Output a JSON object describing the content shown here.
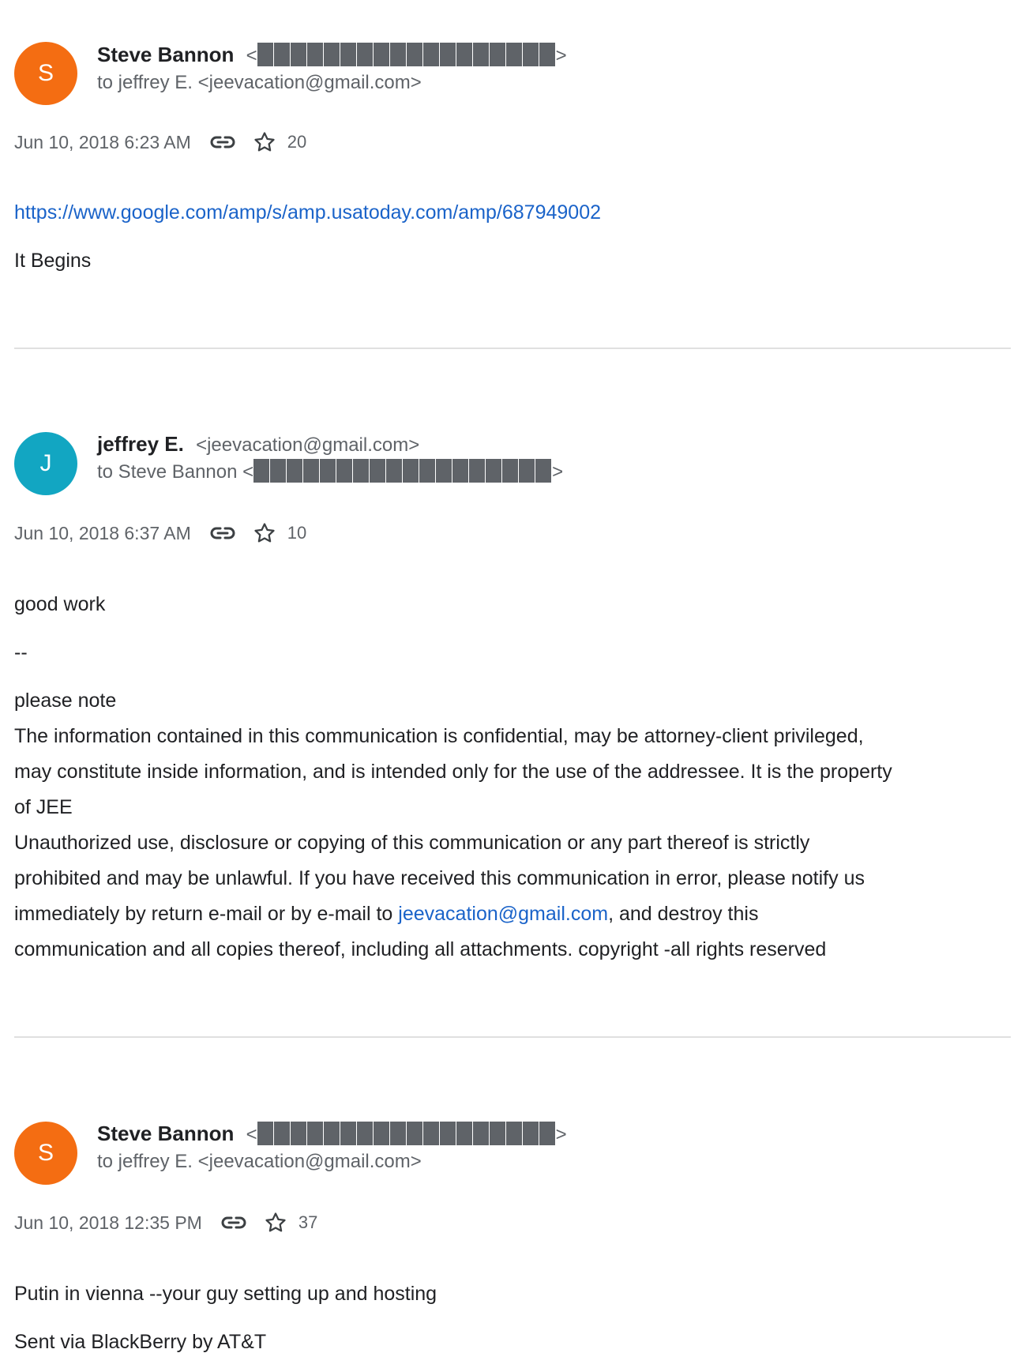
{
  "messages": [
    {
      "avatar_letter": "S",
      "avatar_color": "#f46d12",
      "sender_name": "Steve Bannon",
      "sender_addr_open": "<",
      "sender_addr_close": ">",
      "recipient_line": "to jeffrey E. <jeevacation@gmail.com>",
      "timestamp": "Jun 10, 2018 6:23 AM",
      "star_count": "20",
      "link_text": "https://www.google.com/amp/s/amp.usatoday.com/amp/687949002",
      "body": "It Begins"
    },
    {
      "avatar_letter": "J",
      "avatar_color": "#12a6c2",
      "sender_name": "jeffrey E.",
      "sender_addr": "<jeevacation@gmail.com>",
      "recipient_prefix": "to Steve Bannon <",
      "recipient_suffix": ">",
      "timestamp": "Jun 10, 2018 6:37 AM",
      "star_count": "10",
      "body_line1": "good work",
      "body_sig": "--",
      "disclaimer_title": "please note",
      "disclaimer_lines": [
        "The information contained in this communication is confidential, may be attorney-client privileged,",
        "may constitute inside information, and is intended only for the use of the addressee. It is the property",
        "of JEE",
        "Unauthorized use, disclosure or copying of this communication or any part thereof is strictly",
        "prohibited and may be unlawful. If you have received this communication in error, please notify us"
      ],
      "disclaimer_line6_pre": "immediately by return e-mail or by e-mail to ",
      "disclaimer_line6_link": "jeevacation@gmail.com",
      "disclaimer_line6_post": ", and destroy this",
      "disclaimer_line7": "communication and all copies thereof, including all attachments. copyright -all rights reserved"
    },
    {
      "avatar_letter": "S",
      "avatar_color": "#f46d12",
      "sender_name": "Steve Bannon",
      "sender_addr_open": "<",
      "sender_addr_close": ">",
      "recipient_line": "to jeffrey E. <jeevacation@gmail.com>",
      "timestamp": "Jun 10, 2018 12:35 PM",
      "star_count": "37",
      "body": "Putin in vienna --your guy setting up and hosting",
      "signature": "Sent via BlackBerry by AT&T"
    }
  ],
  "colors": {
    "link": "#1a63c9",
    "meta_text": "#5f6368",
    "redaction": "#5f6368",
    "divider": "#e0e0e0"
  }
}
